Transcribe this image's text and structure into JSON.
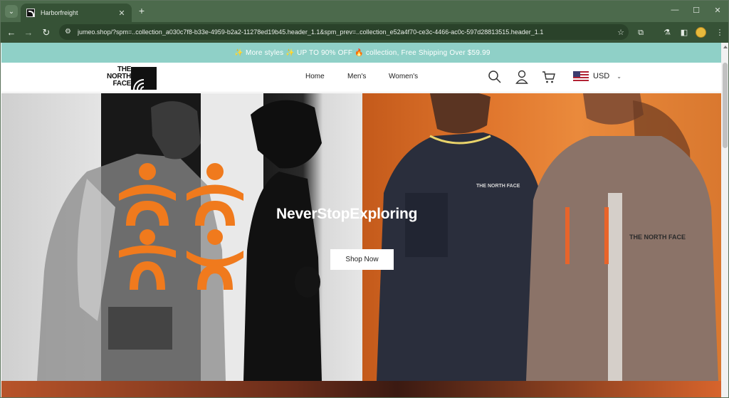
{
  "browser": {
    "tab_title": "Harborfreight",
    "url": "jumeo.shop/?spm=..collection_a030c7f8-b33e-4959-b2a2-11278ed19b45.header_1.1&spm_prev=..collection_e52a4f70-ce3c-4466-ac0c-597d28813515.header_1.1"
  },
  "announcement": {
    "spark_left": "✨",
    "part1": "More styles",
    "spark_mid": "✨",
    "part2": "UP TO 90% OFF",
    "fire": "🔥",
    "part3": "collection, Free Shipping Over $59.99"
  },
  "header": {
    "logo_text": "THE NORTH FACE",
    "nav": [
      "Home",
      "Men's",
      "Women's"
    ],
    "currency": "USD"
  },
  "hero": {
    "title": "NeverStopExploring",
    "cta": "Shop Now",
    "vest_brand": "THE NORTH FACE"
  },
  "colors": {
    "announcement_bg": "#8fd0c7",
    "accent_orange": "#f07a1d",
    "browser_chrome": "#365236"
  }
}
